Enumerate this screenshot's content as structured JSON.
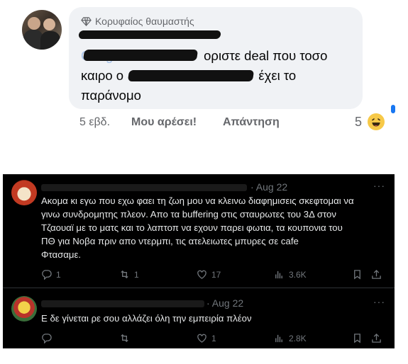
{
  "facebook_comment": {
    "badge": "Κορυφαίος θαυμαστής",
    "line1_tail": "οριστε deal που τοσο",
    "line2_start": "καιρο ο",
    "line2_tail": "έχει το",
    "line3": "παράνομο",
    "time": "5 εβδ.",
    "like_label": "Μου αρέσει!",
    "reply_label": "Απάντηση",
    "reaction_count": "5",
    "link_color": "#216fdb",
    "bubble_color": "#f0f2f5"
  },
  "tweets": [
    {
      "date": "· Aug 22",
      "text_lines": [
        "Ακομα κι εγω που εχω φαει τη ζωη μου να κλεινω διαφημισεις σκεφτομαι να",
        "γινω συνδρομητης πλεον. Απο τα buffering στις σταυρωτες του 3Δ στον",
        "Τζαουαϊ με το ματς και το λαπτοπ να εχουν παρει φωτια, τα κουπονια του",
        "ΠΘ για Νοβα πριν απο ντερμπι, τις ατελειωτες μπυρες σε cafe",
        "Φτασαμε."
      ],
      "replies": "1",
      "retweets": "1",
      "likes": "17",
      "views": "3.6K"
    },
    {
      "date": "· Aug 22",
      "text_lines": [
        "Ε δε γίνεται ρε σου αλλάζει όλη την εμπειρία πλέον"
      ],
      "replies": "",
      "retweets": "",
      "likes": "1",
      "views": "2.8K"
    }
  ]
}
